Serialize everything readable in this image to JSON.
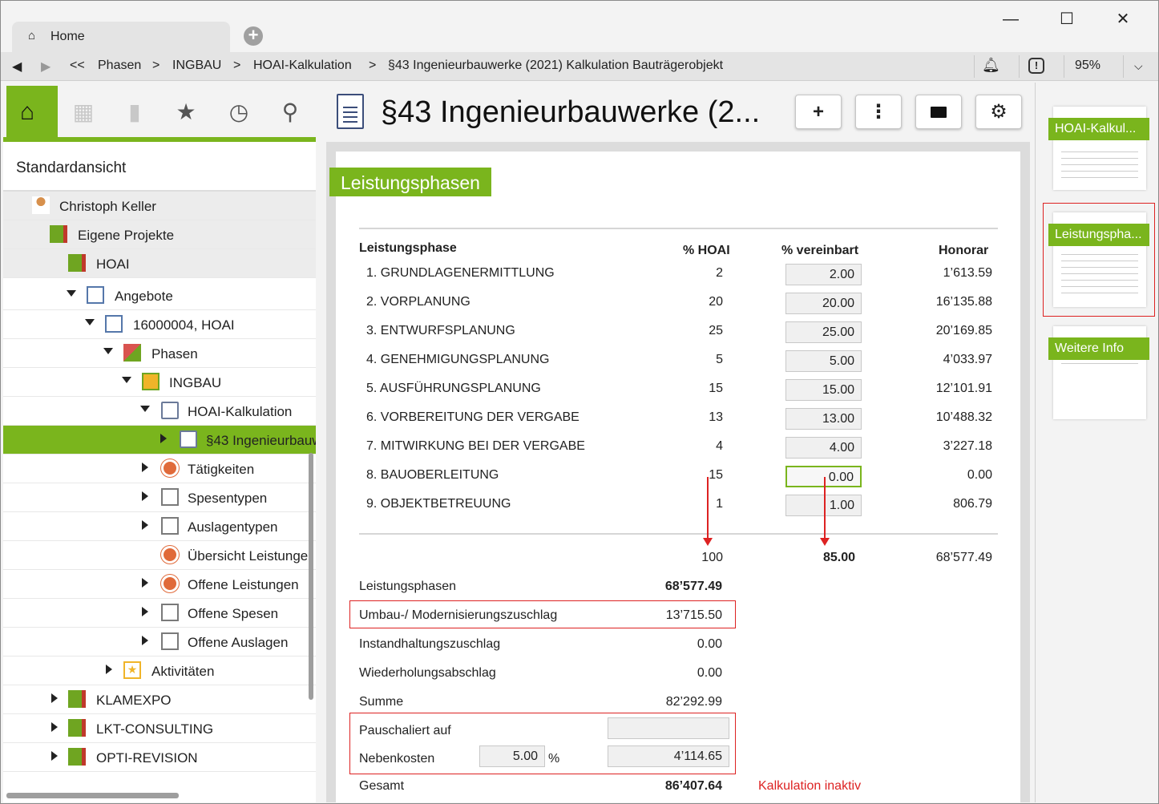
{
  "window": {
    "tab_label": "Home",
    "minimize": "—",
    "maximize": "☐",
    "close": "✕"
  },
  "nav": {
    "back": "◀",
    "forward": "▶",
    "up": "<<",
    "crumbs": [
      "Phasen",
      "INGBAU",
      "HOAI-Kalkulation",
      "§43 Ingenieurbauwerke (2021) Kalkulation Bauträgerobjekt"
    ],
    "separator": ">",
    "zoom": "95%"
  },
  "sidebar": {
    "view_title": "Standardansicht",
    "tree": [
      {
        "label": "Christoph Keller",
        "level": 0
      },
      {
        "label": "Eigene Projekte",
        "level": 1
      },
      {
        "label": "HOAI",
        "level": 2
      },
      {
        "label": "Angebote",
        "level": 3
      },
      {
        "label": "16000004, HOAI",
        "level": 4
      },
      {
        "label": "Phasen",
        "level": 5
      },
      {
        "label": "INGBAU",
        "level": 6
      },
      {
        "label": "HOAI-Kalkulation",
        "level": 7
      },
      {
        "label": "§43 Ingenieurbauw",
        "level": 8
      },
      {
        "label": "Tätigkeiten",
        "level": 7
      },
      {
        "label": "Spesentypen",
        "level": 7
      },
      {
        "label": "Auslagentypen",
        "level": 7
      },
      {
        "label": "Übersicht Leistunge",
        "level": 7
      },
      {
        "label": "Offene Leistungen",
        "level": 7
      },
      {
        "label": "Offene Spesen",
        "level": 7
      },
      {
        "label": "Offene Auslagen",
        "level": 7
      },
      {
        "label": "Aktivitäten",
        "level": 5
      },
      {
        "label": "KLAMEXPO",
        "level": 2
      },
      {
        "label": "LKT-CONSULTING",
        "level": 2
      },
      {
        "label": "OPTI-REVISION",
        "level": 2
      }
    ]
  },
  "main": {
    "title": "§43 Ingenieurbauwerke (2...",
    "toolbar": {
      "add": "+",
      "more": "⋮",
      "folder": "▆",
      "settings": "⚙"
    },
    "section": "Leistungsphasen",
    "headers": {
      "phase": "Leistungsphase",
      "hoai": "% HOAI",
      "agreed": "% vereinbart",
      "fee": "Honorar"
    },
    "rows": [
      {
        "name": "1. GRUNDLAGENERMITTLUNG",
        "hoai": "2",
        "agreed": "2.00",
        "fee": "1’613.59"
      },
      {
        "name": "2. VORPLANUNG",
        "hoai": "20",
        "agreed": "20.00",
        "fee": "16’135.88"
      },
      {
        "name": "3. ENTWURFSPLANUNG",
        "hoai": "25",
        "agreed": "25.00",
        "fee": "20’169.85"
      },
      {
        "name": "4. GENEHMIGUNGSPLANUNG",
        "hoai": "5",
        "agreed": "5.00",
        "fee": "4’033.97"
      },
      {
        "name": "5. AUSFÜHRUNGSPLANUNG",
        "hoai": "15",
        "agreed": "15.00",
        "fee": "12’101.91"
      },
      {
        "name": "6. VORBEREITUNG DER VERGABE",
        "hoai": "13",
        "agreed": "13.00",
        "fee": "10’488.32"
      },
      {
        "name": "7. MITWIRKUNG BEI DER VERGABE",
        "hoai": "4",
        "agreed": "4.00",
        "fee": "3’227.18"
      },
      {
        "name": "8. BAUOBERLEITUNG",
        "hoai": "15",
        "agreed": "0.00",
        "fee": "0.00"
      },
      {
        "name": "9. OBJEKTBETREUUNG",
        "hoai": "1",
        "agreed": "1.00",
        "fee": "806.79"
      }
    ],
    "totals": {
      "hoai": "100",
      "agreed": "85.00",
      "fee": "68’577.49"
    },
    "summary": [
      {
        "label": "Leistungsphasen",
        "value": "68’577.49"
      },
      {
        "label": "Umbau-/ Modernisierungszuschlag",
        "value": "13’715.50"
      },
      {
        "label": "Instandhaltungszuschlag",
        "value": "0.00"
      },
      {
        "label": "Wiederholungsabschlag",
        "value": "0.00"
      },
      {
        "label": "Summe",
        "value": "82’292.99"
      }
    ],
    "flat_label": "Pauschaliert auf",
    "flat_value": "",
    "extra_label": "Nebenkosten",
    "extra_percent": "5.00",
    "extra_percent_unit": "%",
    "extra_value": "4’114.65",
    "total_label": "Gesamt",
    "total_value": "86’407.64",
    "status": "Kalkulation inaktiv"
  },
  "right_panel": {
    "thumbs": [
      "HOAI-Kalkul...",
      "Leistungspha...",
      "Weitere Info"
    ]
  },
  "colors": {
    "accent": "#7ab51d",
    "highlight": "#dd2222"
  }
}
